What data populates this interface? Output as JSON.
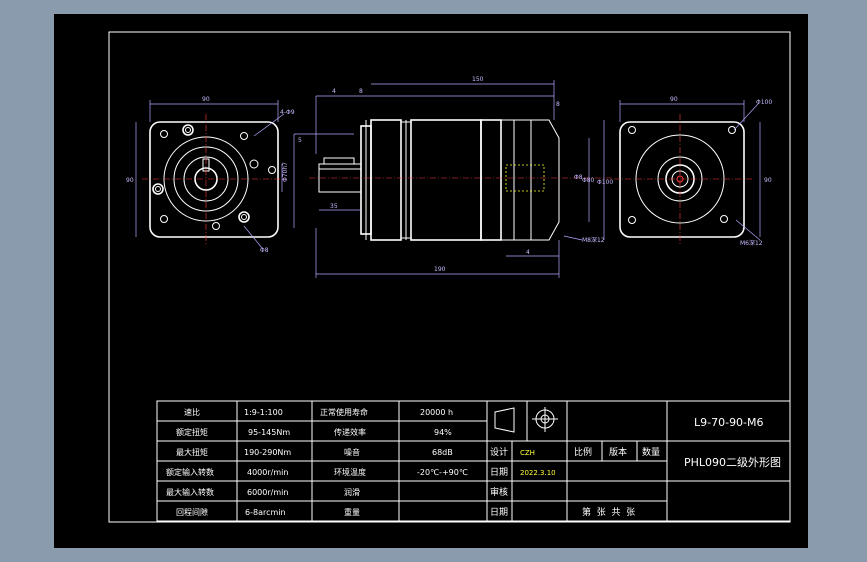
{
  "spec_table": {
    "rows": [
      {
        "label": "速比",
        "value": "1:9-1:100",
        "label2": "正常使用寿命",
        "value2": "20000 h"
      },
      {
        "label": "额定扭矩",
        "value": "95-145Nm",
        "label2": "传递效率",
        "value2": "94%"
      },
      {
        "label": "最大扭矩",
        "value": "190-290Nm",
        "label2": "噪音",
        "value2": "68dB"
      },
      {
        "label": "额定输入转数",
        "value": "4000r/min",
        "label2": "环境温度",
        "value2": "-20℃-+90℃"
      },
      {
        "label": "最大输入转数",
        "value": "6000r/min",
        "label2": "润滑",
        "value2": ""
      },
      {
        "label": "回程间隙",
        "value": "6-8arcmin",
        "label2": "重量",
        "value2": ""
      }
    ]
  },
  "title_block": {
    "drawing_number": "L9-70-90-M6",
    "drawing_name": "PHL090二级外形图",
    "design_label": "设计",
    "designer": "CZH",
    "date_label": "日期",
    "date_value": "2022.3.10",
    "review_label": "审核",
    "date2_label": "日期",
    "scale_label": "比例",
    "version_label": "版本",
    "quantity_label": "数量",
    "sheet_text": "第  张  共  张"
  },
  "dimensions": {
    "front_width": "90",
    "front_hole": "4-Φ9",
    "front_height": "90",
    "front_circle": "Φ8",
    "side_d1": "4",
    "side_d2": "8",
    "side_total": "150",
    "side_d3": "8",
    "side_shaft": "35",
    "side_key": "5",
    "side_bore": "Φ70h7",
    "side_d4": "Φ8",
    "side_d5": "Φ80",
    "side_d6": "Φ100",
    "side_bottom": "190",
    "side_depth": "M8深12",
    "side_d7": "4",
    "rear_width": "90",
    "rear_hole": "Φ100",
    "rear_d1": "M6深12",
    "rear_height": "90"
  }
}
